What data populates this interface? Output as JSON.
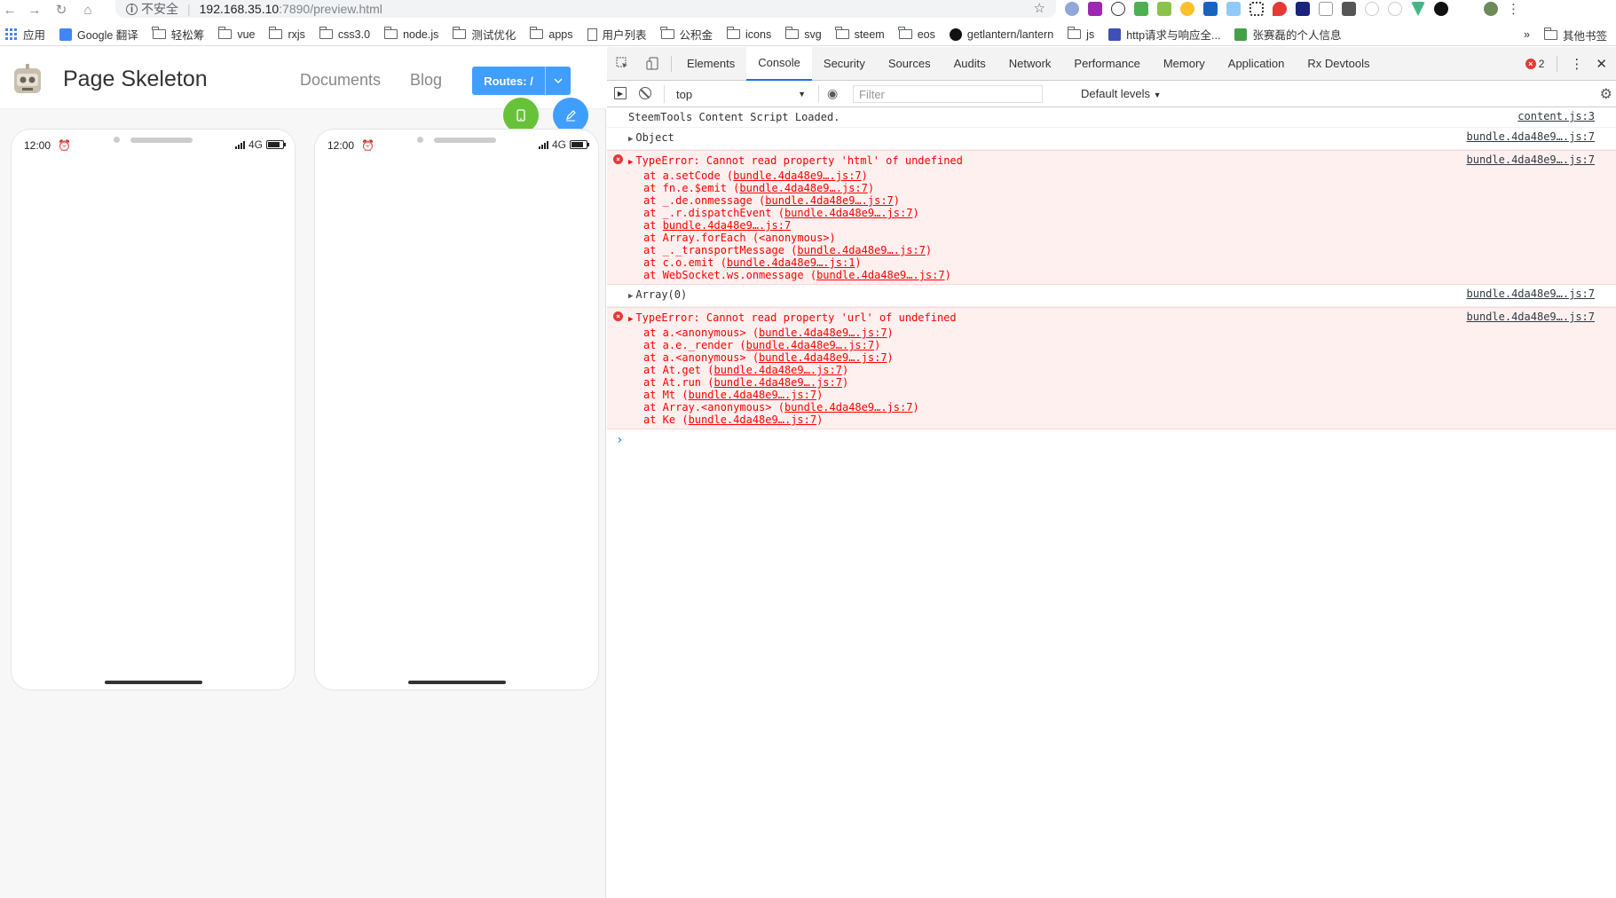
{
  "browser": {
    "insecure_label": "不安全",
    "url_host": "192.168.35.10",
    "url_rest": ":7890/preview.html",
    "bookmarks": [
      {
        "label": "应用",
        "icon": "apps-grid-icon"
      },
      {
        "label": "Google 翻译",
        "icon": "translate-icon"
      },
      {
        "label": "轻松筹",
        "icon": "folder-icon"
      },
      {
        "label": "vue",
        "icon": "folder-icon"
      },
      {
        "label": "rxjs",
        "icon": "folder-icon"
      },
      {
        "label": "css3.0",
        "icon": "folder-icon"
      },
      {
        "label": "node.js",
        "icon": "folder-icon"
      },
      {
        "label": "测试优化",
        "icon": "folder-icon"
      },
      {
        "label": "apps",
        "icon": "folder-icon"
      },
      {
        "label": "用户列表",
        "icon": "page-icon"
      },
      {
        "label": "公积金",
        "icon": "folder-icon"
      },
      {
        "label": "icons",
        "icon": "folder-icon"
      },
      {
        "label": "svg",
        "icon": "folder-icon"
      },
      {
        "label": "steem",
        "icon": "folder-icon"
      },
      {
        "label": "eos",
        "icon": "folder-icon"
      },
      {
        "label": "getlantern/lantern",
        "icon": "github-icon"
      },
      {
        "label": "js",
        "icon": "folder-icon"
      },
      {
        "label": "http请求与响应全...",
        "icon": "site-icon"
      },
      {
        "label": "张赛磊的个人信息",
        "icon": "site-icon"
      }
    ],
    "more_label": "»",
    "other_bookmarks": "其他书签"
  },
  "app": {
    "title": "Page Skeleton",
    "nav": [
      "Documents",
      "Blog"
    ],
    "routes_label": "Routes: /",
    "phones": [
      {
        "time": "12:00",
        "network": "4G"
      },
      {
        "time": "12:00",
        "network": "4G"
      }
    ]
  },
  "devtools": {
    "tabs": [
      "Elements",
      "Console",
      "Security",
      "Sources",
      "Audits",
      "Network",
      "Performance",
      "Memory",
      "Application",
      "Rx Devtools"
    ],
    "active_tab": "Console",
    "error_count": "2",
    "context": "top",
    "filter_placeholder": "Filter",
    "levels": "Default levels",
    "messages": [
      {
        "type": "log",
        "text": "SteemTools Content Script Loaded.",
        "source": "content.js:3"
      },
      {
        "type": "object",
        "text": "Object",
        "source": "bundle.4da48e9….js:7"
      },
      {
        "type": "error",
        "text": "TypeError: Cannot read property 'html' of undefined",
        "source": "bundle.4da48e9….js:7",
        "frames": [
          {
            "fn": "at a.setCode (",
            "link": "bundle.4da48e9….js:7",
            "end": ")"
          },
          {
            "fn": "at fn.e.$emit (",
            "link": "bundle.4da48e9….js:7",
            "end": ")"
          },
          {
            "fn": "at _.de.onmessage (",
            "link": "bundle.4da48e9….js:7",
            "end": ")"
          },
          {
            "fn": "at _.r.dispatchEvent (",
            "link": "bundle.4da48e9….js:7",
            "end": ")"
          },
          {
            "fn": "at ",
            "link": "bundle.4da48e9….js:7",
            "end": ""
          },
          {
            "fn": "at Array.forEach (<anonymous>)",
            "link": "",
            "end": ""
          },
          {
            "fn": "at _._transportMessage (",
            "link": "bundle.4da48e9….js:7",
            "end": ")"
          },
          {
            "fn": "at c.o.emit (",
            "link": "bundle.4da48e9….js:1",
            "end": ")"
          },
          {
            "fn": "at WebSocket.ws.onmessage (",
            "link": "bundle.4da48e9….js:7",
            "end": ")"
          }
        ]
      },
      {
        "type": "object",
        "text": "Array(0)",
        "source": "bundle.4da48e9….js:7"
      },
      {
        "type": "error",
        "text": "TypeError: Cannot read property 'url' of undefined",
        "source": "bundle.4da48e9….js:7",
        "frames": [
          {
            "fn": "at a.<anonymous> (",
            "link": "bundle.4da48e9….js:7",
            "end": ")"
          },
          {
            "fn": "at a.e._render (",
            "link": "bundle.4da48e9….js:7",
            "end": ")"
          },
          {
            "fn": "at a.<anonymous> (",
            "link": "bundle.4da48e9….js:7",
            "end": ")"
          },
          {
            "fn": "at At.get (",
            "link": "bundle.4da48e9….js:7",
            "end": ")"
          },
          {
            "fn": "at At.run (",
            "link": "bundle.4da48e9….js:7",
            "end": ")"
          },
          {
            "fn": "at Mt (",
            "link": "bundle.4da48e9….js:7",
            "end": ")"
          },
          {
            "fn": "at Array.<anonymous> (",
            "link": "bundle.4da48e9….js:7",
            "end": ")"
          },
          {
            "fn": "at Ke (",
            "link": "bundle.4da48e9….js:7",
            "end": ")"
          }
        ]
      }
    ],
    "prompt": "›"
  },
  "colors": {
    "primary": "#409eff",
    "green_fab": "#67c23a",
    "error": "#ff0000",
    "error_bg": "#fff0f0"
  }
}
